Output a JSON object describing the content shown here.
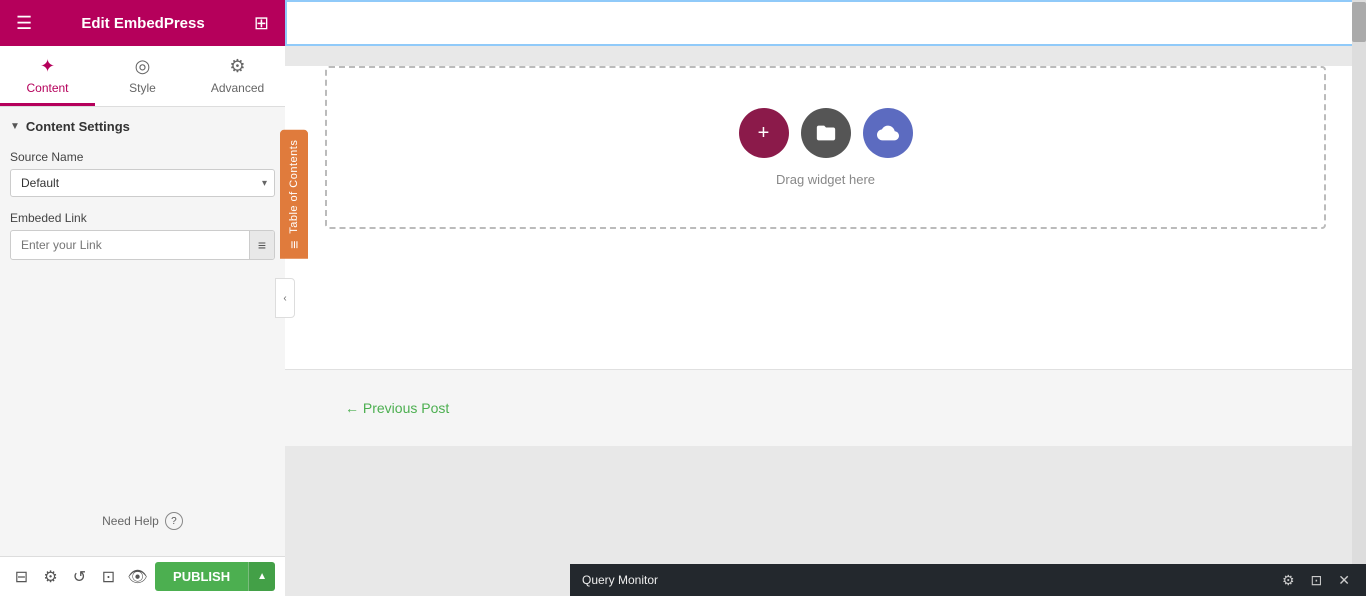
{
  "sidebar": {
    "header": {
      "title": "Edit EmbedPress",
      "hamburger": "☰",
      "grid": "⊞"
    },
    "tabs": [
      {
        "id": "content",
        "label": "Content",
        "icon": "✦",
        "active": true
      },
      {
        "id": "style",
        "label": "Style",
        "icon": "◎",
        "active": false
      },
      {
        "id": "advanced",
        "label": "Advanced",
        "icon": "⚙",
        "active": false
      }
    ],
    "section": {
      "title": "Content Settings",
      "collapsed": false
    },
    "source_name_label": "Source Name",
    "source_name_default": "Default",
    "embed_link_label": "Embeded Link",
    "embed_link_placeholder": "Enter your Link"
  },
  "toc": {
    "label": "Table of Contents",
    "icon": "≡"
  },
  "help": {
    "label": "Need Help",
    "icon": "?"
  },
  "bottom_bar": {
    "icons": [
      "layers-icon",
      "settings-icon",
      "undo-icon",
      "grid-icon",
      "eye-icon"
    ],
    "publish_label": "PUBLISH",
    "arrow_label": "▲"
  },
  "canvas": {
    "drag_text": "Drag widget here",
    "widget_icons": [
      "+",
      "🗀",
      "☁"
    ]
  },
  "prev_post": {
    "arrow": "←",
    "label": "Previous Post"
  },
  "query_monitor": {
    "label": "Query Monitor"
  }
}
